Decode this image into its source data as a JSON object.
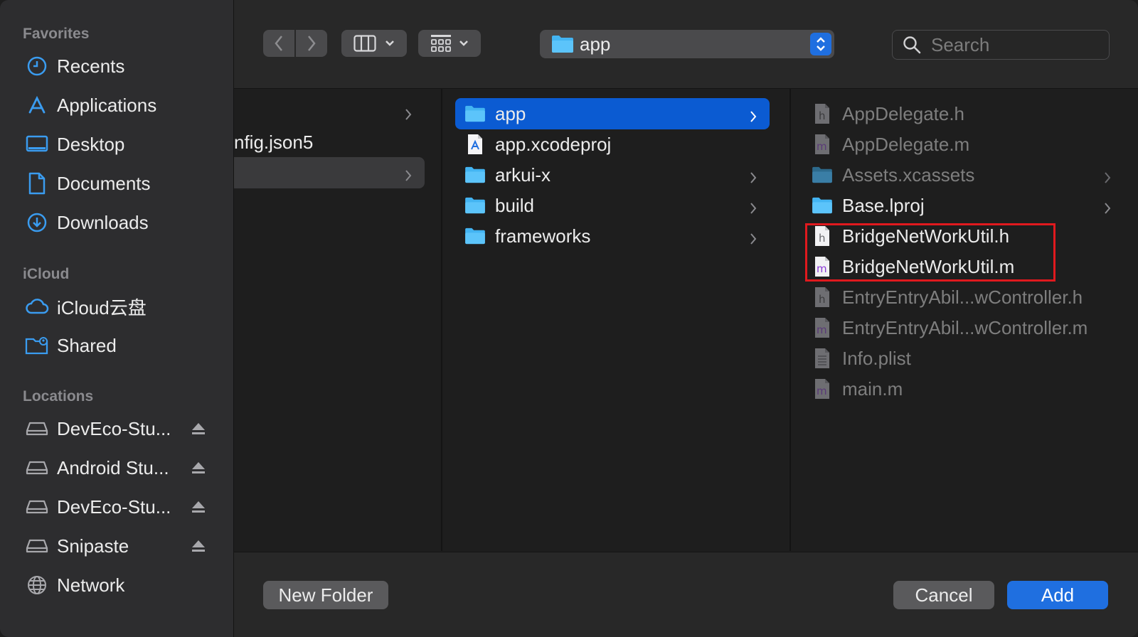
{
  "sidebar": {
    "favorites_header": "Favorites",
    "favorites": [
      {
        "label": "Recents",
        "icon": "clock-icon"
      },
      {
        "label": "Applications",
        "icon": "applications-icon"
      },
      {
        "label": "Desktop",
        "icon": "desktop-icon"
      },
      {
        "label": "Documents",
        "icon": "document-icon"
      },
      {
        "label": "Downloads",
        "icon": "download-icon"
      }
    ],
    "icloud_header": "iCloud",
    "icloud": [
      {
        "label": "iCloud云盘",
        "icon": "cloud-icon"
      },
      {
        "label": "Shared",
        "icon": "shared-folder-icon"
      }
    ],
    "locations_header": "Locations",
    "locations": [
      {
        "label": "DevEco-Stu...",
        "icon": "disk-icon",
        "ejectable": true
      },
      {
        "label": "Android Stu...",
        "icon": "disk-icon",
        "ejectable": true
      },
      {
        "label": "DevEco-Stu...",
        "icon": "disk-icon",
        "ejectable": true
      },
      {
        "label": "Snipaste",
        "icon": "disk-icon",
        "ejectable": true
      },
      {
        "label": "Network",
        "icon": "globe-icon",
        "ejectable": false
      }
    ]
  },
  "toolbar": {
    "current_folder": "app",
    "search_placeholder": "Search"
  },
  "columns": {
    "col1": [
      {
        "label": "",
        "has_children": true,
        "state": "normal"
      },
      {
        "label": "nfig.json5",
        "has_children": false,
        "state": "normal"
      },
      {
        "label": "",
        "has_children": true,
        "state": "highlighted"
      }
    ],
    "col2": [
      {
        "label": "app",
        "icon": "folder-icon",
        "has_children": true,
        "state": "selected"
      },
      {
        "label": "app.xcodeproj",
        "icon": "xcodeproj-icon",
        "has_children": false,
        "state": "normal"
      },
      {
        "label": "arkui-x",
        "icon": "folder-icon",
        "has_children": true,
        "state": "normal"
      },
      {
        "label": "build",
        "icon": "folder-icon",
        "has_children": true,
        "state": "normal"
      },
      {
        "label": "frameworks",
        "icon": "folder-icon",
        "has_children": true,
        "state": "normal"
      }
    ],
    "col3": [
      {
        "label": "AppDelegate.h",
        "icon": "h-file-icon",
        "letter": "h",
        "has_children": false,
        "enabled": false
      },
      {
        "label": "AppDelegate.m",
        "icon": "m-file-icon",
        "letter": "m",
        "has_children": false,
        "enabled": false
      },
      {
        "label": "Assets.xcassets",
        "icon": "folder-icon",
        "has_children": true,
        "enabled": false
      },
      {
        "label": "Base.lproj",
        "icon": "folder-icon",
        "has_children": true,
        "enabled": true
      },
      {
        "label": "BridgeNetWorkUtil.h",
        "icon": "h-file-icon",
        "letter": "h",
        "has_children": false,
        "enabled": true
      },
      {
        "label": "BridgeNetWorkUtil.m",
        "icon": "m-file-icon",
        "letter": "m",
        "has_children": false,
        "enabled": true
      },
      {
        "label": "EntryEntryAbil...wController.h",
        "icon": "h-file-icon",
        "letter": "h",
        "has_children": false,
        "enabled": false
      },
      {
        "label": "EntryEntryAbil...wController.m",
        "icon": "m-file-icon",
        "letter": "m",
        "has_children": false,
        "enabled": false
      },
      {
        "label": "Info.plist",
        "icon": "plist-file-icon",
        "has_children": false,
        "enabled": false
      },
      {
        "label": "main.m",
        "icon": "m-file-icon",
        "letter": "m",
        "has_children": false,
        "enabled": false
      }
    ]
  },
  "footer": {
    "new_folder_label": "New Folder",
    "cancel_label": "Cancel",
    "add_label": "Add"
  },
  "colors": {
    "accent": "#0b5bd2",
    "annotation": "#e0191e",
    "folder": "#43b4f2"
  }
}
